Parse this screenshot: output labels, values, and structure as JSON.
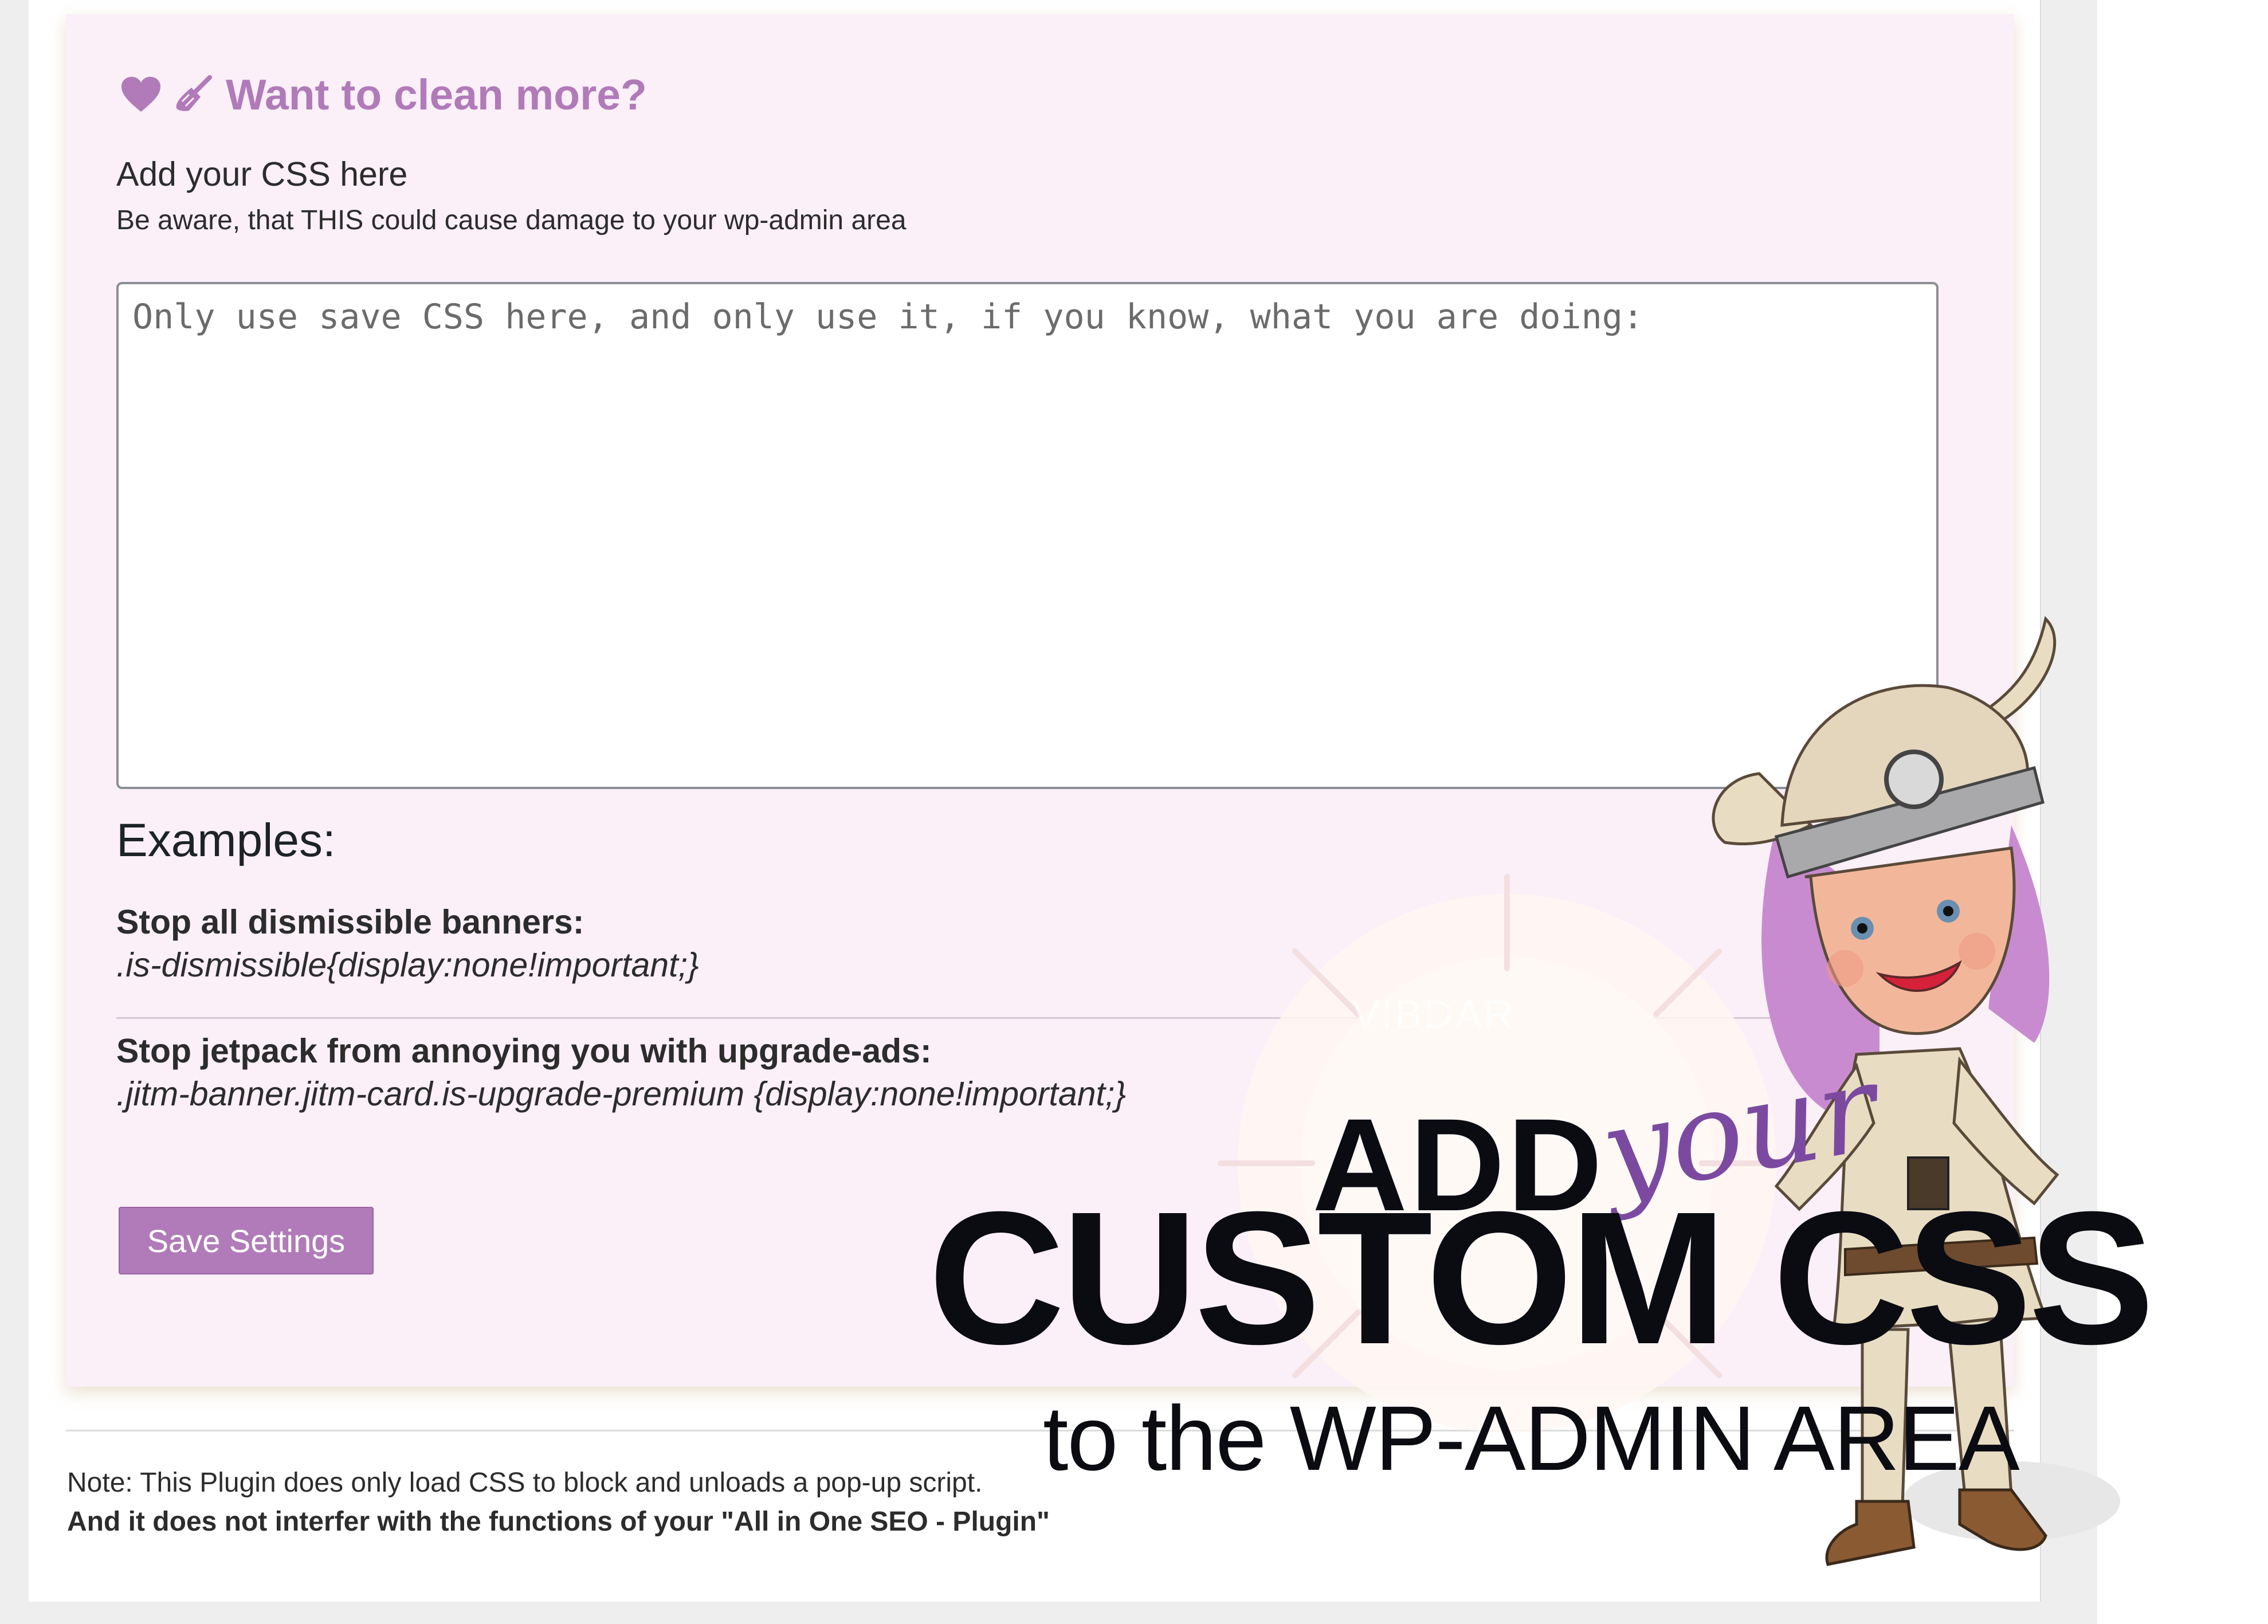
{
  "card": {
    "title": "Want to clean more?",
    "lead": "Add your CSS here",
    "warning": "Be aware, that THIS could cause damage to your wp-admin area",
    "css_input": {
      "value": "",
      "placeholder": "Only use save CSS here, and only use it, if you know, what you are doing:"
    },
    "examples_heading": "Examples:",
    "examples": [
      {
        "title": "Stop all dismissible banners:",
        "code": ".is-dismissible{display:none!important;}"
      },
      {
        "title": "Stop jetpack from annoying you with upgrade-ads:",
        "code": ".jitm-banner.jitm-card.is-upgrade-premium {display:none!important;}"
      }
    ],
    "save_label": "Save Settings"
  },
  "footer": {
    "note_line1": "Note: This Plugin does only load CSS to block and unloads a pop-up script.",
    "note_line2": "And it does not interfer with the functions of your \"All in One SEO - Plugin\""
  },
  "promo": {
    "line_add": "ADD",
    "line_your": "your",
    "line_custom": "CUSTOM CSS",
    "line_sub": "to the WP-ADMIN AREA",
    "watermark": "VIBDAR"
  },
  "icons": [
    "heart-icon",
    "broom-icon"
  ],
  "colors": {
    "accent": "#b07bb8",
    "card_bg": "#fbeff8",
    "button_bg": "#b07bb8",
    "headline": "#0b0b12",
    "script": "#7b4aa0"
  }
}
